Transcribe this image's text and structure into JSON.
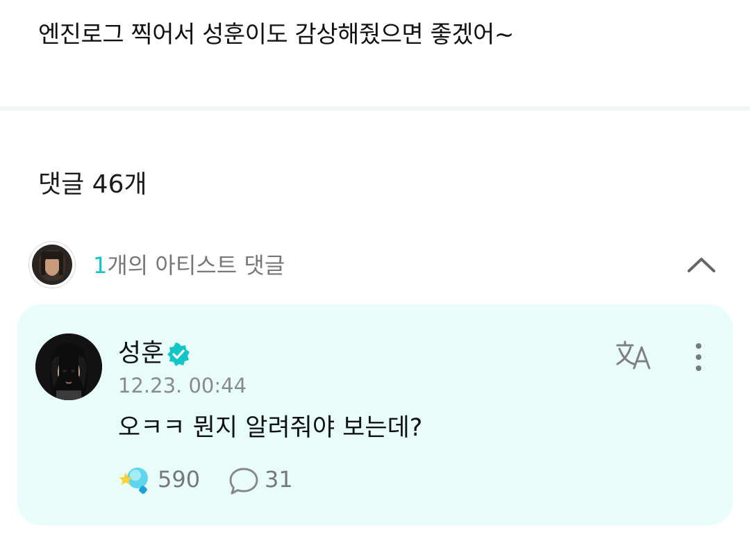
{
  "post": {
    "text": "엔진로그 찍어서 성훈이도 감상해줬으면 좋겠어~"
  },
  "comments_header": {
    "label": "댓글 46개"
  },
  "artist_comments": {
    "count": "1",
    "label_suffix": "개의 아티스트 댓글",
    "collapse_icon": "chevron-up-icon"
  },
  "comment": {
    "author": "성훈",
    "verified_icon": "verified-badge-icon",
    "timestamp": "12.23. 00:44",
    "body": "오ㅋㅋ 뭔지 알려줘야 보는데?",
    "likes": "590",
    "replies": "31",
    "translate_icon": "translate-icon",
    "more_icon": "more-vertical-icon",
    "like_icon": "star-lightstick-icon",
    "reply_icon": "speech-bubble-icon"
  },
  "colors": {
    "accent": "#11c4c4",
    "card_background": "#e8fdf9",
    "muted_text": "#8a8a8a",
    "divider": "#f4f5f6"
  }
}
